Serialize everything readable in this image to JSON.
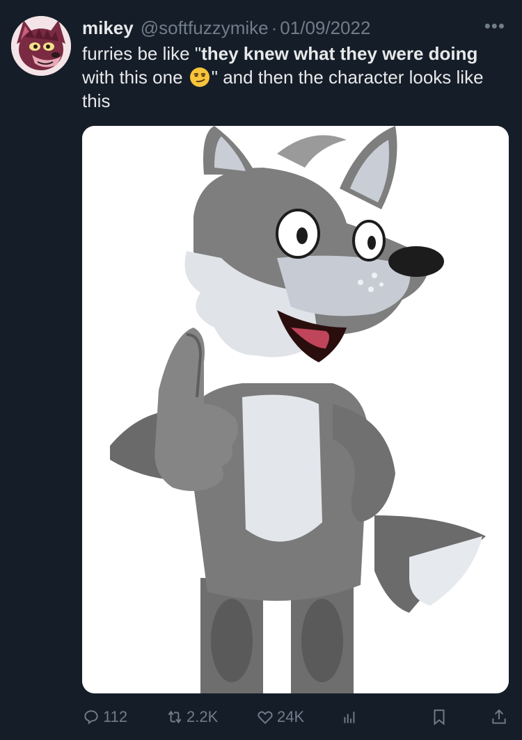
{
  "author": {
    "name": "mikey",
    "handle": "@softfuzzymike",
    "separator": "·",
    "date": "01/09/2022",
    "avatar_icon": "wolf-avatar-icon"
  },
  "more_label": "•••",
  "tweet": {
    "part1": "furries be like \"",
    "bold": "they knew what they were doing",
    "part2": " with this one ",
    "emoji": "smirking-face-emoji",
    "part3": "\" and then the character looks like this"
  },
  "media": {
    "description_icon": "cartoon-wolf-thumbs-up-image"
  },
  "actions": {
    "replies": "112",
    "retweets": "2.2K",
    "likes": "24K"
  },
  "colors": {
    "background": "#151d28",
    "text": "#e7e9ea",
    "muted": "#717d8a"
  }
}
